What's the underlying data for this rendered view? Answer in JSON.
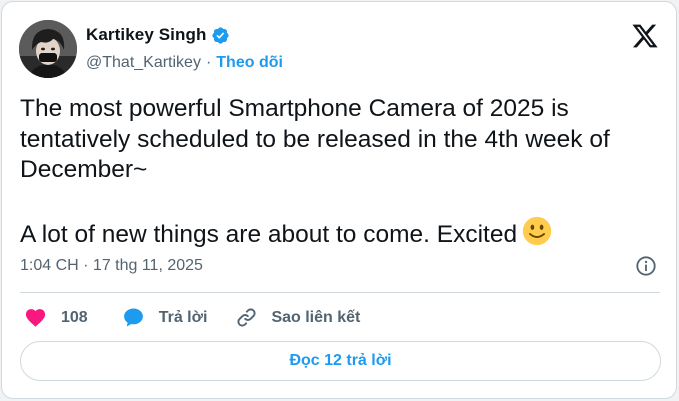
{
  "author": {
    "name": "Kartikey Singh",
    "handle": "@That_Kartikey",
    "separator": "·",
    "follow_label": "Theo dõi",
    "verified_icon": "verified-badge-icon",
    "avatar_icon": "avatar"
  },
  "brand": {
    "logo_icon": "x-logo-icon"
  },
  "tweet": {
    "text": "The most powerful Smartphone Camera of 2025 is\ntentatively scheduled to be released in the 4th week of\nDecember~\n\nA lot of new things are about to come. Excited",
    "emoji": "slightly-smiling-face-emoji",
    "timestamp": "1:04 CH · 17 thg 11, 2025"
  },
  "actions": {
    "like_count": "108",
    "reply_label": "Trả lời",
    "copy_link_label": "Sao liên kết",
    "read_replies_label": "Đọc 12 trả lời"
  },
  "colors": {
    "accent": "#1d9bf0",
    "like": "#f91880",
    "text": "#0f1419",
    "muted": "#536471",
    "border": "#cfd9de"
  }
}
